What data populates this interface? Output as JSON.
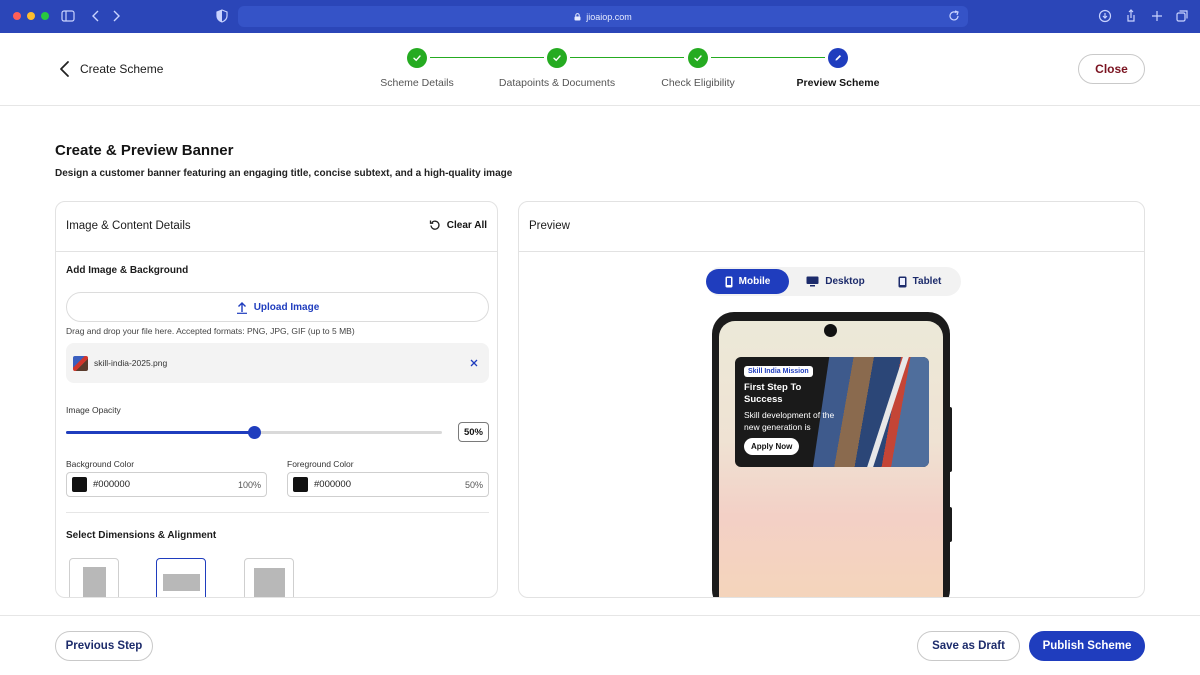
{
  "browser": {
    "url": "jioaiop.com"
  },
  "header": {
    "title": "Create Scheme",
    "close_label": "Close",
    "steps": [
      {
        "label": "Scheme Details",
        "state": "done"
      },
      {
        "label": "Datapoints & Documents",
        "state": "done"
      },
      {
        "label": "Check Eligibility",
        "state": "done"
      },
      {
        "label": "Preview Scheme",
        "state": "active"
      }
    ]
  },
  "page": {
    "title": "Create & Preview Banner",
    "subtitle": "Design a customer banner featuring an engaging title, concise subtext, and a high-quality image"
  },
  "details": {
    "title": "Image & Content Details",
    "clear_all": "Clear All",
    "image_section": "Add Image & Background",
    "upload_label": "Upload Image",
    "upload_hint": "Drag and drop your file here. Accepted formats: PNG, JPG, GIF (up to 5 MB)",
    "file_name": "skill-india-2025.png",
    "opacity_label": "Image Opacity",
    "opacity_value": "50%",
    "opacity_fraction": 0.5,
    "background": {
      "label": "Background Color",
      "hex": "#000000",
      "percent": "100%"
    },
    "foreground": {
      "label": "Foreground Color",
      "hex": "#000000",
      "percent": "50%"
    },
    "dimensions_section": "Select Dimensions & Alignment"
  },
  "preview": {
    "title": "Preview",
    "tabs": [
      {
        "label": "Mobile",
        "icon": "mobile-icon",
        "active": true
      },
      {
        "label": "Desktop",
        "icon": "desktop-icon",
        "active": false
      },
      {
        "label": "Tablet",
        "icon": "tablet-icon",
        "active": false
      }
    ],
    "banner": {
      "tag": "Skill India Mission",
      "title": "First Step To Success",
      "description": "Skill development of the new generation is",
      "cta": "Apply Now"
    }
  },
  "footer": {
    "previous": "Previous Step",
    "draft": "Save as Draft",
    "publish": "Publish Scheme"
  },
  "colors": {
    "primary": "#1f3dbe",
    "success": "#25ab21",
    "close_text": "#7a1320"
  }
}
